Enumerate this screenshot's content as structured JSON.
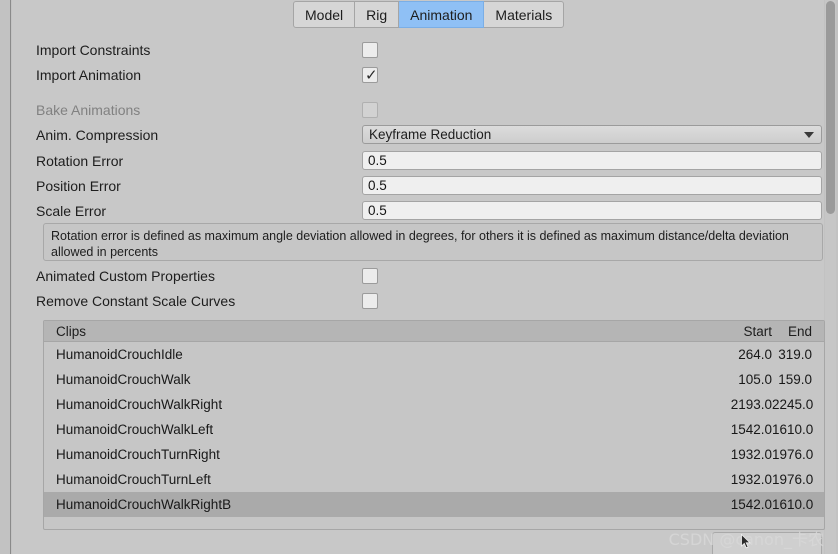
{
  "tabs": [
    {
      "label": "Model",
      "active": false
    },
    {
      "label": "Rig",
      "active": false
    },
    {
      "label": "Animation",
      "active": true
    },
    {
      "label": "Materials",
      "active": false
    }
  ],
  "properties": {
    "import_constraints": {
      "label": "Import Constraints",
      "checked": false,
      "disabled": false
    },
    "import_animation": {
      "label": "Import Animation",
      "checked": true,
      "disabled": false
    },
    "bake_animations": {
      "label": "Bake Animations",
      "checked": false,
      "disabled": true
    },
    "anim_compression": {
      "label": "Anim. Compression",
      "value": "Keyframe Reduction"
    },
    "rotation_error": {
      "label": "Rotation Error",
      "value": "0.5"
    },
    "position_error": {
      "label": "Position Error",
      "value": "0.5"
    },
    "scale_error": {
      "label": "Scale Error",
      "value": "0.5"
    },
    "animated_custom_properties": {
      "label": "Animated Custom Properties",
      "checked": false
    },
    "remove_constant_scale_curves": {
      "label": "Remove Constant Scale Curves",
      "checked": false
    }
  },
  "helpbox": {
    "text": "Rotation error is defined as maximum angle deviation allowed in degrees, for others it is defined as maximum distance/delta deviation allowed in percents"
  },
  "clips": {
    "columns": {
      "name": "Clips",
      "start": "Start",
      "end": "End"
    },
    "rows": [
      {
        "name": "HumanoidCrouchIdle",
        "start": "264.0",
        "end": "319.0",
        "selected": false
      },
      {
        "name": "HumanoidCrouchWalk",
        "start": "105.0",
        "end": "159.0",
        "selected": false
      },
      {
        "name": "HumanoidCrouchWalkRight",
        "start": "2193.0",
        "end": "2245.0",
        "selected": false
      },
      {
        "name": "HumanoidCrouchWalkLeft",
        "start": "1542.0",
        "end": "1610.0",
        "selected": false
      },
      {
        "name": "HumanoidCrouchTurnRight",
        "start": "1932.0",
        "end": "1976.0",
        "selected": false
      },
      {
        "name": "HumanoidCrouchTurnLeft",
        "start": "1932.0",
        "end": "1976.0",
        "selected": false
      },
      {
        "name": "HumanoidCrouchWalkRightB",
        "start": "1542.0",
        "end": "1610.0",
        "selected": true
      }
    ]
  },
  "watermark": {
    "text": "CSDN @canon_卡农"
  },
  "colors": {
    "accent": "#8fc0f5",
    "panel": "#c8c8c8",
    "field": "#efefef",
    "selected_row": "#aaaaaa"
  }
}
